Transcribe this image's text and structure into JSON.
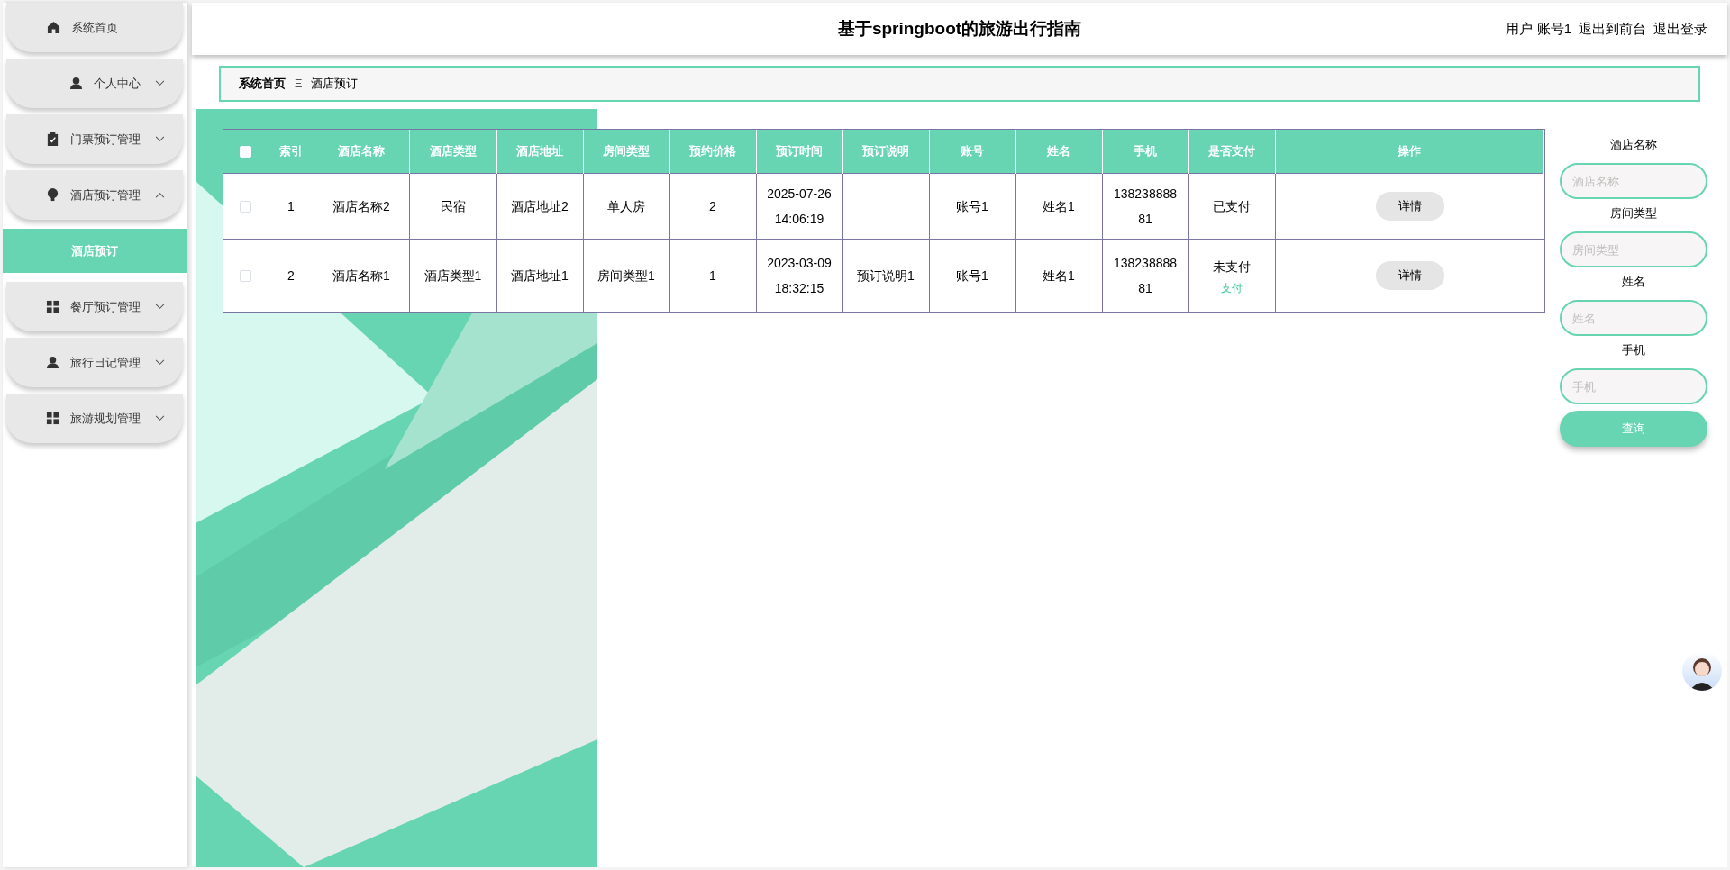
{
  "sidebar": {
    "items": [
      {
        "label": "系统首页"
      },
      {
        "label": "个人中心",
        "expanded": false
      },
      {
        "label": "门票预订管理",
        "expanded": false
      },
      {
        "label": "酒店预订管理",
        "expanded": true,
        "children": [
          {
            "label": "酒店预订",
            "selected": true
          }
        ]
      },
      {
        "label": "餐厅预订管理",
        "expanded": false
      },
      {
        "label": "旅行日记管理",
        "expanded": false
      },
      {
        "label": "旅游规划管理",
        "expanded": false
      }
    ]
  },
  "header": {
    "title": "基于springboot的旅游出行指南",
    "links": [
      "用户 账号1",
      "退出到前台",
      "退出登录"
    ]
  },
  "breadcrumb": {
    "items": [
      "系统首页",
      "酒店预订"
    ],
    "separator": "Ξ"
  },
  "table": {
    "select_all": {
      "checked": false
    },
    "columns": [
      "索引",
      "酒店名称",
      "酒店类型",
      "酒店地址",
      "房间类型",
      "预约价格",
      "预订时间",
      "预订说明",
      "账号",
      "姓名",
      "手机",
      "是否支付",
      "操作"
    ],
    "rows": [
      {
        "checked": false,
        "cells": [
          "1",
          "酒店名称2",
          "民宿",
          "酒店地址2",
          "单人房",
          "2",
          "2025-07-26 14:06:19",
          "",
          "账号1",
          "姓名1",
          "13823888881",
          "已支付"
        ],
        "action": "详情"
      },
      {
        "checked": false,
        "cells": [
          "2",
          "酒店名称1",
          "酒店类型1",
          "酒店地址1",
          "房间类型1",
          "1",
          "2023-03-09 18:32:15",
          "预订说明1",
          "账号1",
          "姓名1",
          "13823888881",
          "未支付"
        ],
        "pay_link": "支付",
        "action": "详情"
      }
    ]
  },
  "search": {
    "fields": [
      {
        "label": "酒店名称",
        "placeholder": "酒店名称"
      },
      {
        "label": "房间类型",
        "placeholder": "房间类型"
      },
      {
        "label": "姓名",
        "placeholder": "姓名"
      },
      {
        "label": "手机",
        "placeholder": "手机"
      }
    ],
    "button": "查询"
  }
}
